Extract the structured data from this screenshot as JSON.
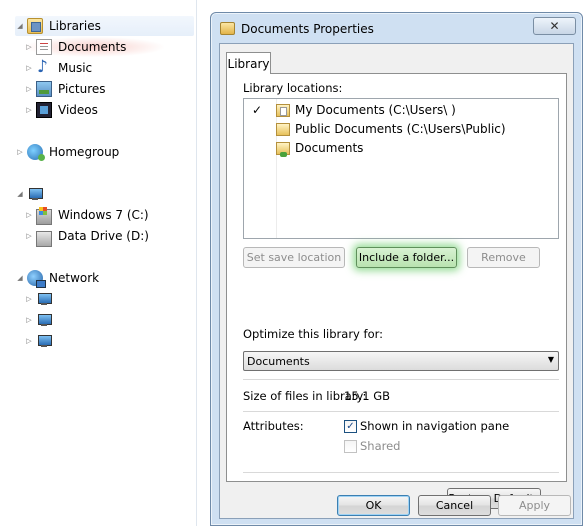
{
  "nav": {
    "libraries": "Libraries",
    "documents": "Documents",
    "music": "Music",
    "pictures": "Pictures",
    "videos": "Videos",
    "homegroup": "Homegroup",
    "windows_drive": "Windows 7 (C:)",
    "data_drive": "Data Drive (D:)",
    "network": "Network"
  },
  "dialog": {
    "title": "Documents Properties",
    "close_glyph": "✕",
    "tab": "Library",
    "library_locations_label": "Library locations:",
    "locations": [
      {
        "checked": "✓",
        "text": "My Documents (C:\\Users\\       )"
      },
      {
        "checked": "",
        "text": "Public Documents (C:\\Users\\Public)"
      },
      {
        "checked": "",
        "text": "Documents"
      }
    ],
    "buttons": {
      "set_save": "Set save location",
      "include": "Include a folder...",
      "remove": "Remove",
      "restore": "Restore Defaults",
      "ok": "OK",
      "cancel": "Cancel",
      "apply": "Apply"
    },
    "optimize_label": "Optimize this library for:",
    "optimize_value": "Documents",
    "size_label": "Size of files in library:",
    "size_value": "15.1 GB",
    "attributes_label": "Attributes:",
    "attr_shown": "Shown in navigation pane",
    "attr_shown_checked": "✓",
    "attr_shared": "Shared"
  }
}
